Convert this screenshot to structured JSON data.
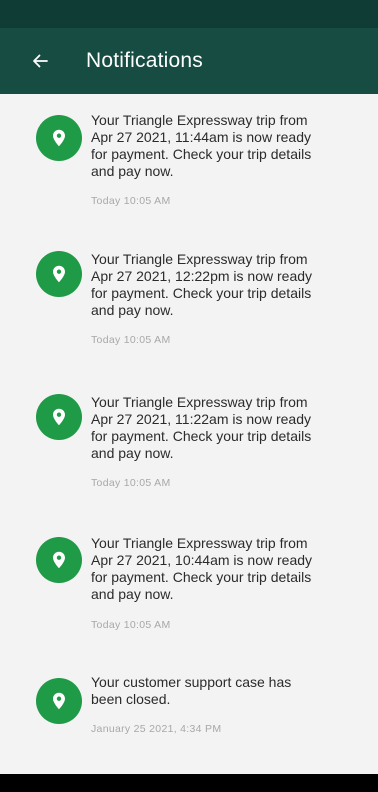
{
  "header": {
    "title": "Notifications"
  },
  "notifications": [
    {
      "message": "Your Triangle Expressway trip from\nApr 27 2021, 11:44am is now ready\nfor payment. Check your trip details\nand pay now.",
      "time": "Today 10:05 AM"
    },
    {
      "message": "Your Triangle Expressway trip from\nApr 27 2021, 12:22pm is now ready\nfor payment. Check your trip details\nand pay now.",
      "time": "Today 10:05 AM"
    },
    {
      "message": "Your Triangle Expressway trip from\nApr 27 2021, 11:22am is now ready\nfor payment. Check your trip details\nand pay now.",
      "time": "Today 10:05 AM"
    },
    {
      "message": "Your Triangle Expressway trip from\nApr 27 2021, 10:44am is now ready\nfor payment. Check your trip details\nand pay now.",
      "time": "Today 10:05 AM"
    },
    {
      "message": "Your customer support case has\nbeen closed.",
      "time": "January 25 2021, 4:34 PM"
    }
  ],
  "colors": {
    "header_bg": "#174c43",
    "status_bar_bg": "#0f3c35",
    "icon_bg": "#1f9a47",
    "list_bg": "#f3f3f3"
  }
}
